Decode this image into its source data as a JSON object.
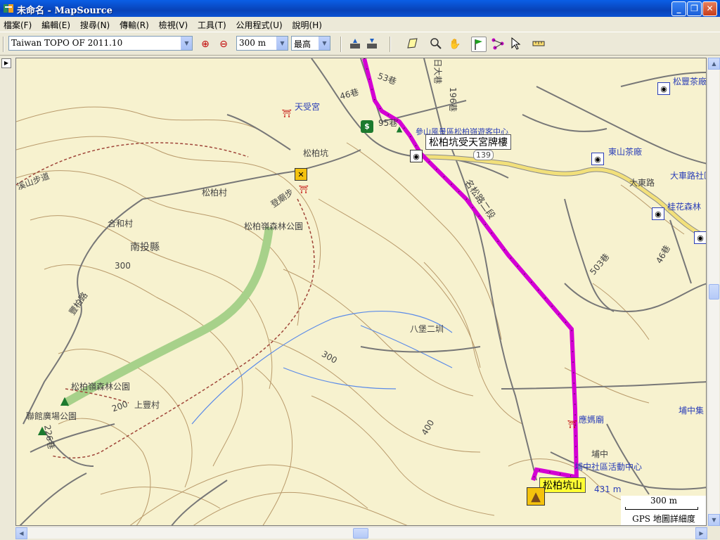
{
  "window": {
    "title": "未命名 - MapSource",
    "minimize": "_",
    "maximize": "❐",
    "close": "✕"
  },
  "menu": [
    "檔案(F)",
    "編輯(E)",
    "搜尋(N)",
    "傳輸(R)",
    "檢視(V)",
    "工具(T)",
    "公用程式(U)",
    "說明(H)"
  ],
  "toolbar": {
    "map_product": "Taiwan TOPO OF 2011.10",
    "zoom_scale": "300 m",
    "detail_level": "最高"
  },
  "map": {
    "labels": [
      {
        "text": "天受宮",
        "blue": true
      },
      {
        "text": "53巷"
      },
      {
        "text": "46巷"
      },
      {
        "text": "196巷"
      },
      {
        "text": "日大巷"
      },
      {
        "text": "95巷"
      },
      {
        "text": "參山風景區松柏嶺遊客中心",
        "blue": true
      },
      {
        "text": "松柏坑"
      },
      {
        "text": "松柏村"
      },
      {
        "text": "登廟步"
      },
      {
        "text": "松柏嶺森林公園"
      },
      {
        "text": "合和村"
      },
      {
        "text": "南投縣"
      },
      {
        "text": "300"
      },
      {
        "text": "豐柏路"
      },
      {
        "text": "溪山步道"
      },
      {
        "text": "松柏嶺森林公園"
      },
      {
        "text": "聯館廣場公園"
      },
      {
        "text": "200"
      },
      {
        "text": "上豐村"
      },
      {
        "text": "226巷"
      },
      {
        "text": "300"
      },
      {
        "text": "400"
      },
      {
        "text": "八堡二圳"
      },
      {
        "text": "名松路二段"
      },
      {
        "text": "139"
      },
      {
        "text": "東山茶廠",
        "blue": true
      },
      {
        "text": "大東路"
      },
      {
        "text": "大車路社區",
        "blue": true
      },
      {
        "text": "桂花森林",
        "blue": true
      },
      {
        "text": "松豐茶廠",
        "blue": true
      },
      {
        "text": "503巷"
      },
      {
        "text": "46巷"
      },
      {
        "text": "應媽廟",
        "blue": true
      },
      {
        "text": "埔中"
      },
      {
        "text": "埔中社區活動中心",
        "blue": true
      },
      {
        "text": "埔中集",
        "blue": true
      },
      {
        "text": "431 m",
        "blue": true
      }
    ],
    "waypoints": [
      {
        "name": "松柏坑受天宮牌樓",
        "style": "white"
      },
      {
        "name": "松柏坑山",
        "style": "yellow"
      }
    ],
    "scale": {
      "label": "300 m",
      "detail": "GPS 地圖詳細度"
    }
  },
  "icons": {
    "zoom_in": "zoom-in-icon",
    "zoom_out": "zoom-out-icon",
    "colors": {
      "route": "#D400D4",
      "land": "#F7F2CF",
      "park": "#A7D18A",
      "contour": "#B99A6B",
      "road_major": "#F2E07A",
      "water": "#5B8BE8"
    }
  }
}
